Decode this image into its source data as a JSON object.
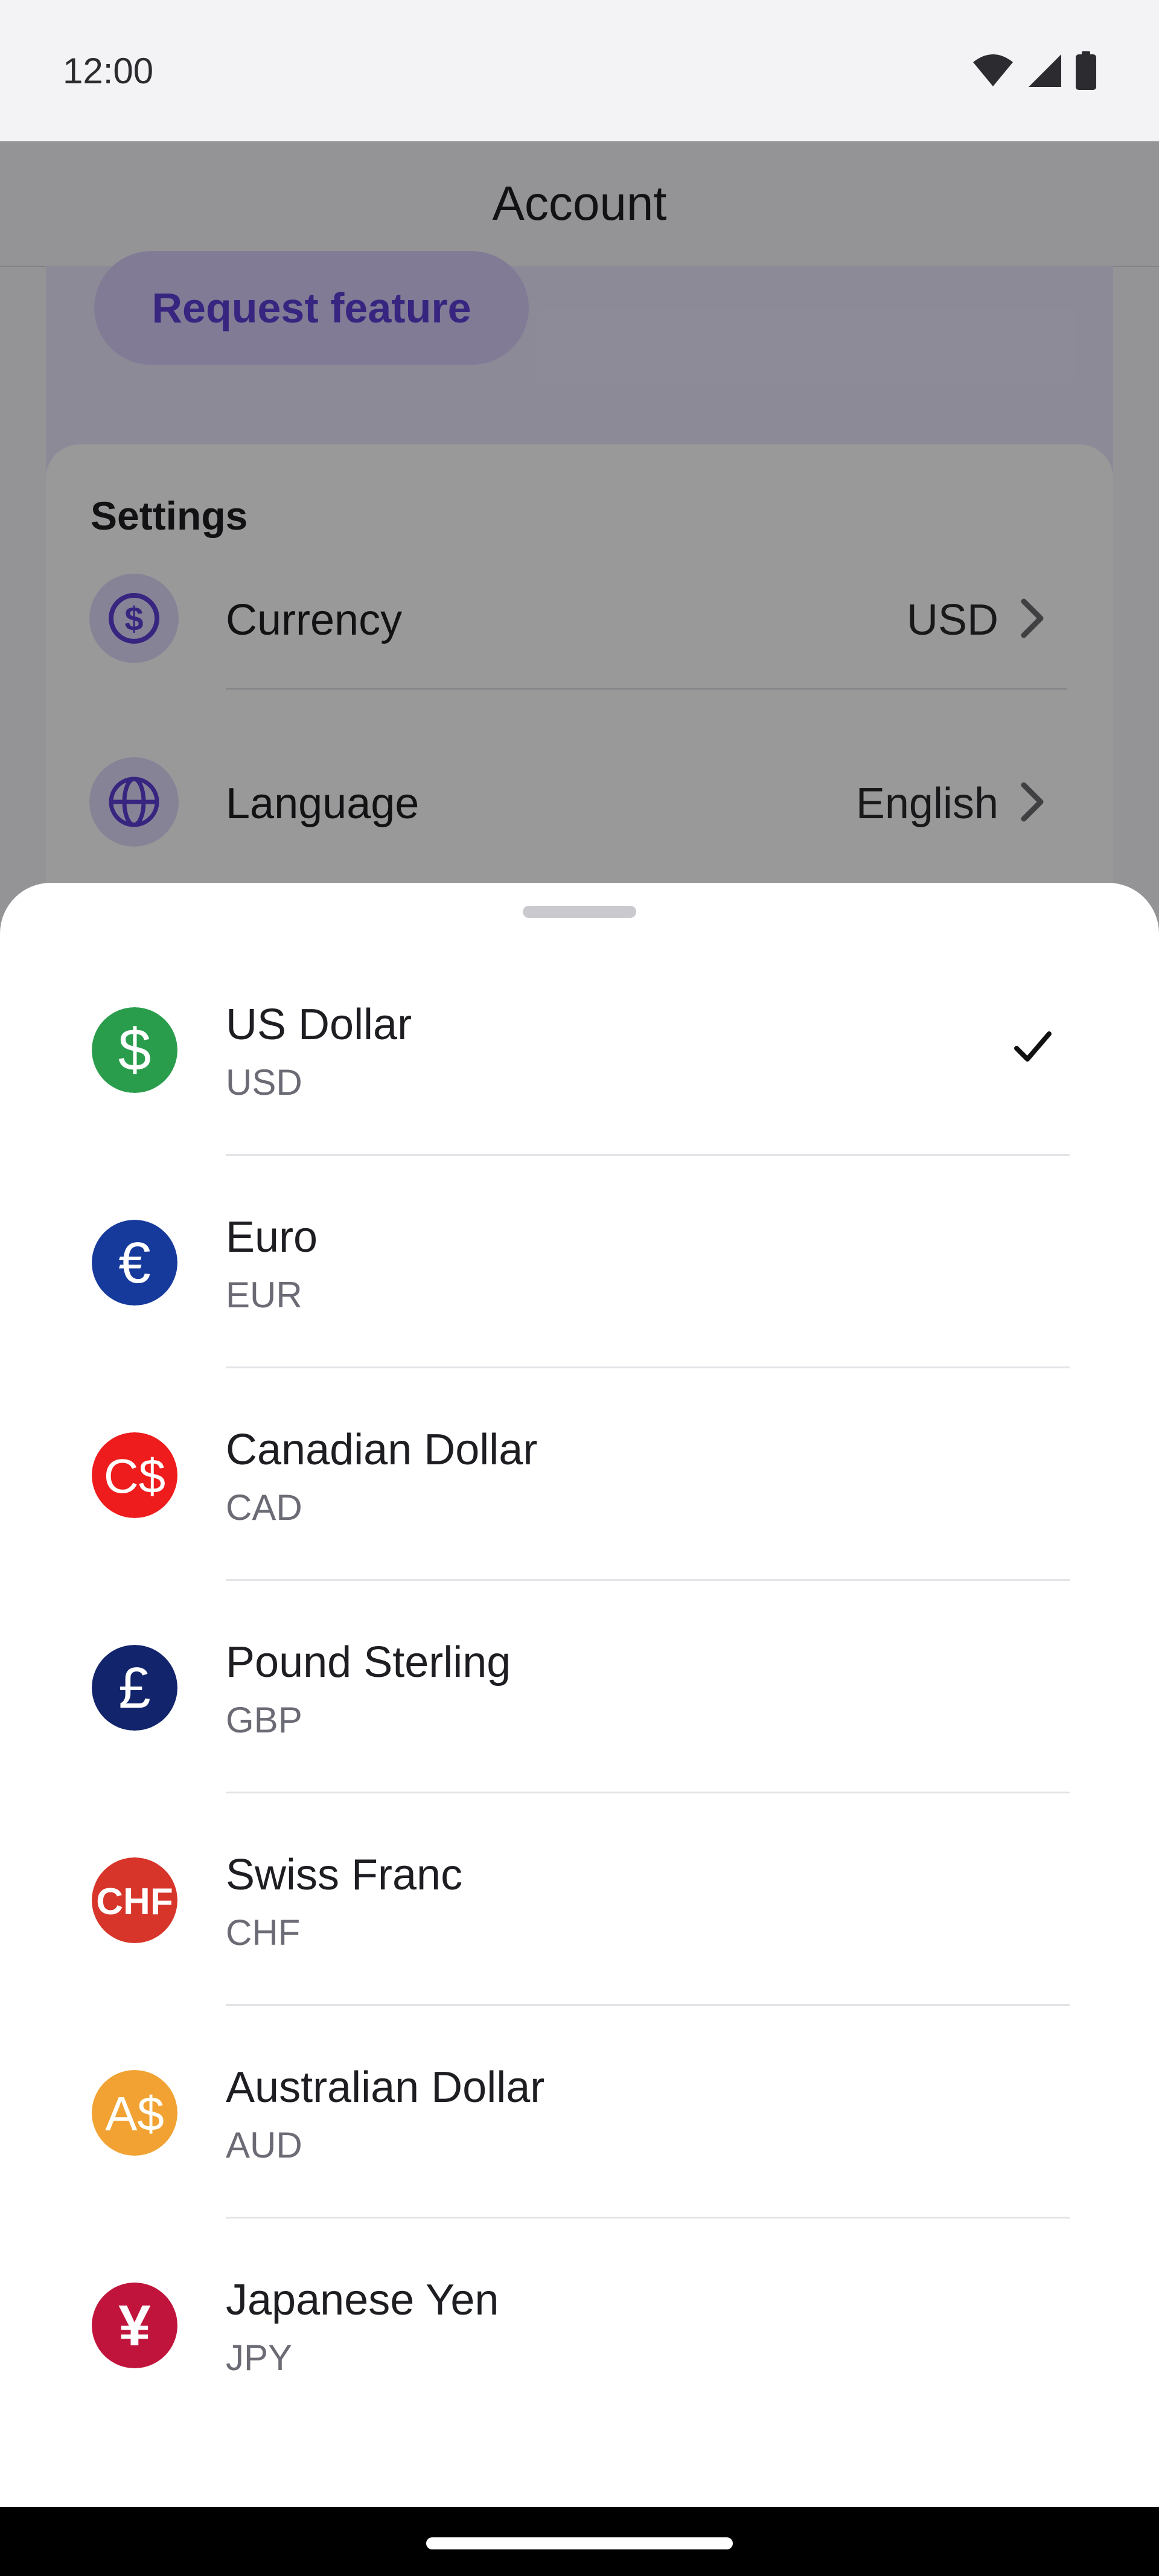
{
  "status_bar": {
    "time": "12:00"
  },
  "header": {
    "title": "Account"
  },
  "feature_card": {
    "request_label": "Request feature"
  },
  "settings": {
    "heading": "Settings",
    "rows": [
      {
        "label": "Currency",
        "value": "USD",
        "icon": "dollar-circle-icon"
      },
      {
        "label": "Language",
        "value": "English",
        "icon": "globe-icon"
      }
    ]
  },
  "currencies": [
    {
      "name": "US Dollar",
      "code": "USD",
      "symbol": "$",
      "color": "#2a9d4d",
      "selected": true
    },
    {
      "name": "Euro",
      "code": "EUR",
      "symbol": "€",
      "color": "#163a9c",
      "selected": false
    },
    {
      "name": "Canadian Dollar",
      "code": "CAD",
      "symbol": "C$",
      "color": "#ee1c1c",
      "selected": false
    },
    {
      "name": "Pound Sterling",
      "code": "GBP",
      "symbol": "£",
      "color": "#12246b",
      "selected": false
    },
    {
      "name": "Swiss Franc",
      "code": "CHF",
      "symbol": "CHF",
      "color": "#d7352a",
      "selected": false
    },
    {
      "name": "Australian Dollar",
      "code": "AUD",
      "symbol": "A$",
      "color": "#f1a232",
      "selected": false
    },
    {
      "name": "Japanese Yen",
      "code": "JPY",
      "symbol": "¥",
      "color": "#c0143c",
      "selected": false
    }
  ],
  "colors": {
    "accent": "#5c3fd6",
    "accent_light": "#e2dafc",
    "scrim": "rgba(0,0,0,0.40)"
  }
}
